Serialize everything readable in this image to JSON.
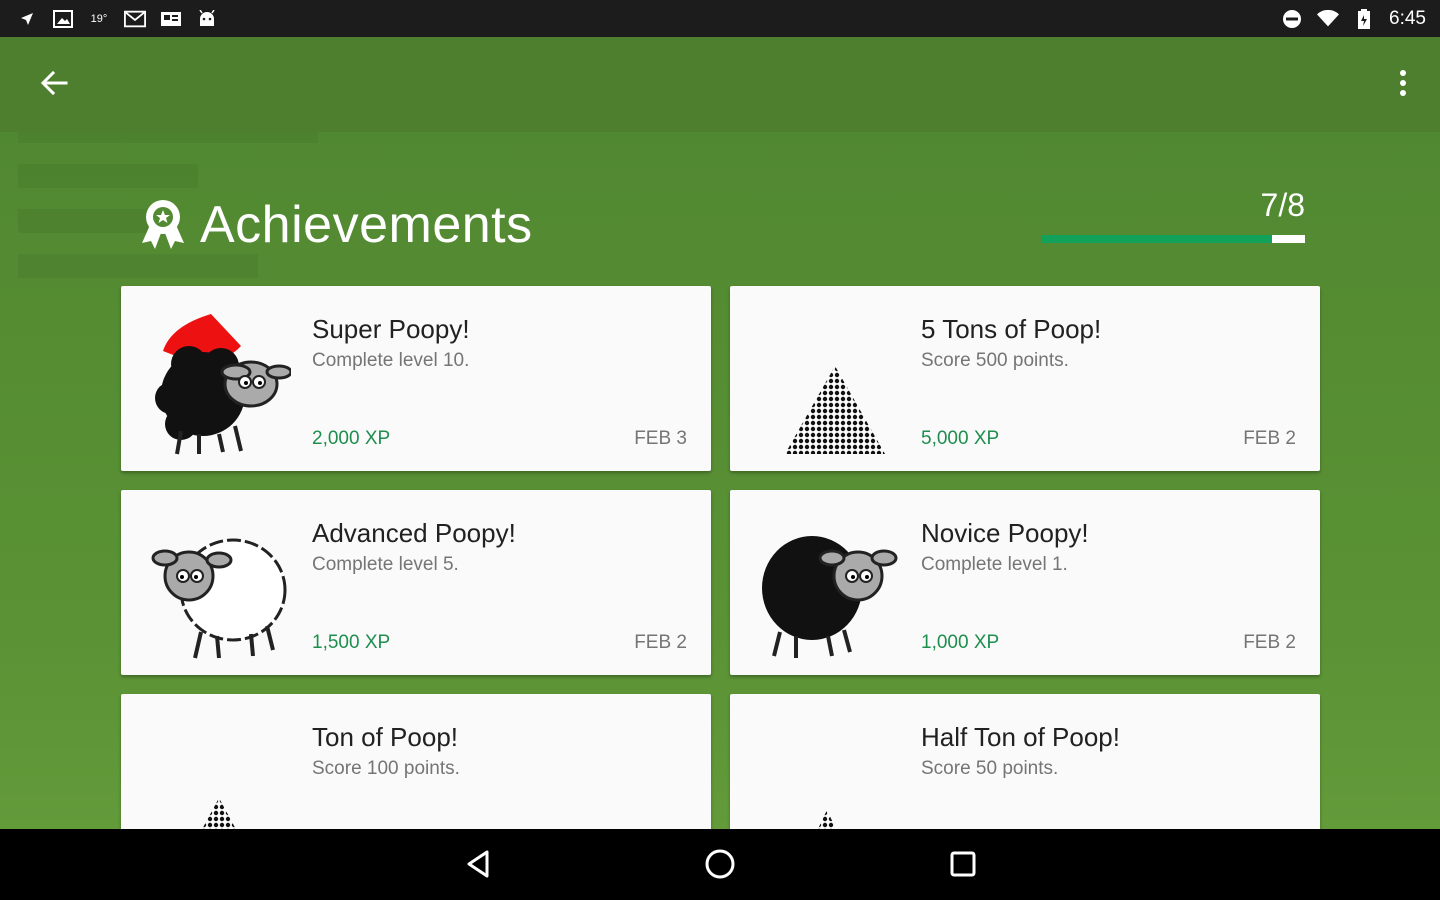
{
  "status_bar": {
    "time": "6:45",
    "temp": "19°",
    "left_icons": [
      "navigation-icon",
      "image-icon",
      "temperature-icon",
      "gmail-icon",
      "news-icon",
      "android-icon"
    ],
    "right_icons": [
      "do-not-disturb-icon",
      "wifi-icon",
      "battery-icon"
    ]
  },
  "app_bar": {
    "back_icon": "arrow-back-icon",
    "menu_icon": "more-vert-icon"
  },
  "header": {
    "title": "Achievements",
    "icon": "award-ribbon-icon",
    "progress_text": "7/8",
    "progress_value": 0.875
  },
  "colors": {
    "background": "#528a31",
    "app_bar": "#4d7f2e",
    "xp": "#1e8e4e",
    "progress": "#12a15a"
  },
  "achievements": [
    {
      "title": "Super Poopy!",
      "description": "Complete level 10.",
      "xp": "2,000 XP",
      "date": "FEB 3",
      "image": "red-caped-black-sheep"
    },
    {
      "title": "5 Tons of Poop!",
      "description": "Score 500 points.",
      "xp": "5,000 XP",
      "date": "FEB 2",
      "image": "large-poop-pile"
    },
    {
      "title": "Advanced Poopy!",
      "description": "Complete level 5.",
      "xp": "1,500 XP",
      "date": "FEB 2",
      "image": "white-sheep"
    },
    {
      "title": "Novice Poopy!",
      "description": "Complete level 1.",
      "xp": "1,000 XP",
      "date": "FEB 2",
      "image": "black-sheep"
    },
    {
      "title": "Ton of Poop!",
      "description": "Score 100 points.",
      "xp": "",
      "date": "",
      "image": "medium-poop-pile"
    },
    {
      "title": "Half Ton of Poop!",
      "description": "Score 50 points.",
      "xp": "",
      "date": "",
      "image": "small-poop-pile"
    }
  ],
  "nav_bar": {
    "back": "nav-back-icon",
    "home": "nav-home-icon",
    "recents": "nav-recents-icon"
  }
}
